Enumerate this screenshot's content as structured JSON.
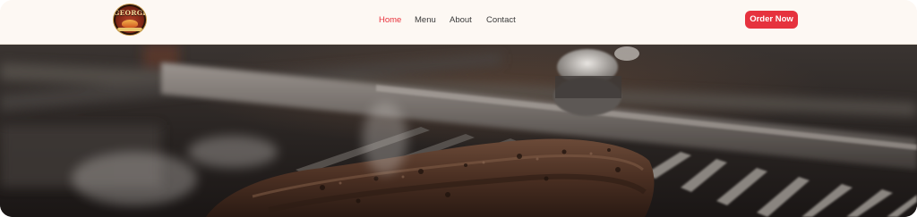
{
  "header": {
    "logo_text": "GEORGE'S",
    "nav": [
      {
        "label": "Home",
        "active": true
      },
      {
        "label": "Menu",
        "active": false
      },
      {
        "label": "About",
        "active": false
      },
      {
        "label": "Contact",
        "active": false
      }
    ],
    "cta_label": "Order Now"
  },
  "colors": {
    "accent": "#e6323e",
    "header_bg": "#fdf8f3",
    "nav_text": "#3a3a3a"
  },
  "hero": {
    "image": "grilled-steak-photo"
  }
}
